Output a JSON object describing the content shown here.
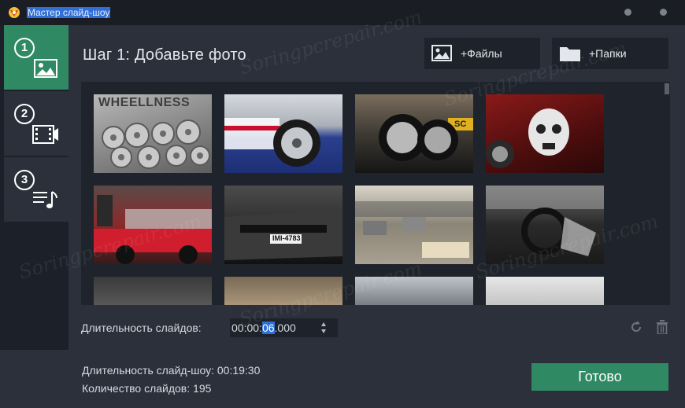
{
  "window": {
    "title": "Мастер слайд-шоу"
  },
  "sidebar": {
    "steps": [
      {
        "number": "1",
        "icon": "image-icon",
        "active": true
      },
      {
        "number": "2",
        "icon": "film-icon",
        "active": false
      },
      {
        "number": "3",
        "icon": "music-list-icon",
        "active": false
      }
    ]
  },
  "header": {
    "title": "Шаг 1: Добавьте фото",
    "add_files_label": "+Файлы",
    "add_folders_label": "+Папки"
  },
  "gallery": {
    "thumbnails": [
      {
        "label": "WHEELLNESS"
      },
      {
        "label": ""
      },
      {
        "label": "SC"
      },
      {
        "label": ""
      },
      {
        "label": ""
      },
      {
        "label": "IMI-4783"
      },
      {
        "label": ""
      },
      {
        "label": ""
      },
      {
        "label": ""
      },
      {
        "label": ""
      },
      {
        "label": ""
      },
      {
        "label": ""
      }
    ]
  },
  "duration": {
    "label": "Длительность слайдов:",
    "value_prefix": "00:00:",
    "value_selected": "06",
    "value_suffix": ".000"
  },
  "footer": {
    "show_duration_label": "Длительность слайд-шоу:",
    "show_duration_value": "00:19:30",
    "slide_count_label": "Количество слайдов:",
    "slide_count_value": "195",
    "done_label": "Готово"
  },
  "watermark": "Soringpcrepair.com",
  "colors": {
    "accent_green": "#2f8a64",
    "selection_blue": "#2f6fd6",
    "panel_bg": "#2b303b",
    "dark_bg": "#1c2029"
  }
}
